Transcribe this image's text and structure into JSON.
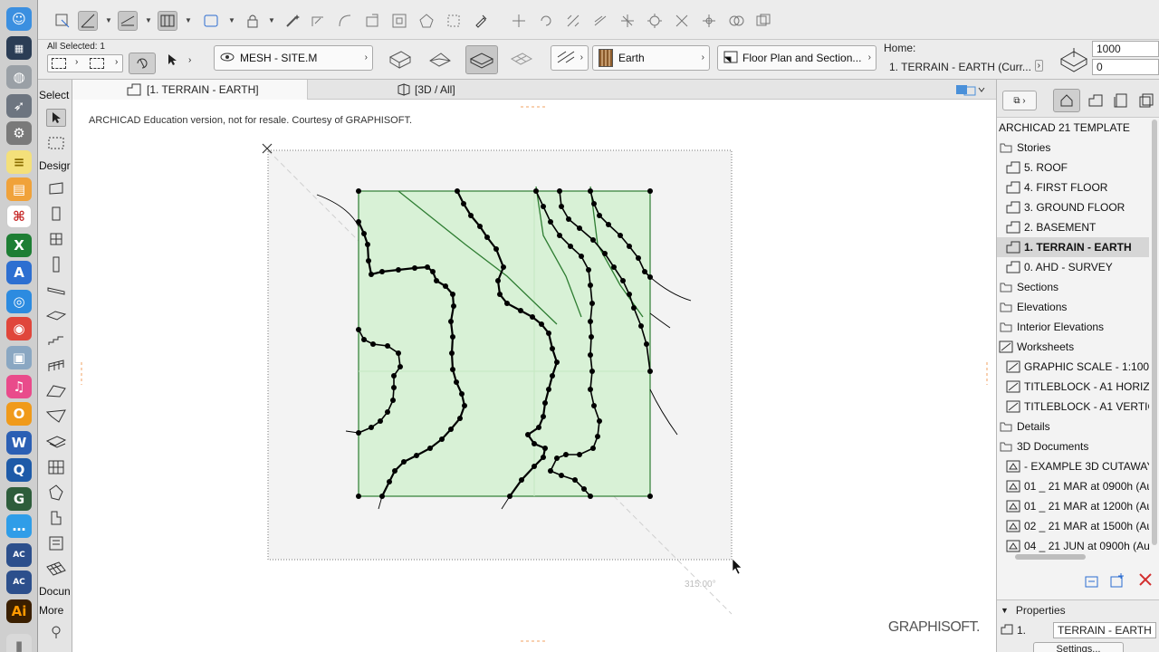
{
  "toolbox": {
    "select_label": "Select",
    "design_label": "Desigr",
    "document_label": "Docun",
    "more_label": "More"
  },
  "infobox": {
    "all_selected": "All Selected: 1",
    "mesh_label": "MESH - SITE.M",
    "surface_label": "Earth",
    "view_label": "Floor Plan and Section...",
    "home_label": "Home:",
    "home_story": "1. TERRAIN - EARTH (Curr...",
    "value_top": "1000",
    "value_bottom": "0"
  },
  "tabs": [
    {
      "label": "[1. TERRAIN - EARTH]"
    },
    {
      "label": "[3D / All]"
    }
  ],
  "canvas": {
    "watermark_note": "ARCHICAD Education version, not for resale. Courtesy of GRAPHISOFT.",
    "angle_label": "315.00°",
    "logo": "GRAPHISOFT."
  },
  "navigator": {
    "project_title": "ARCHICAD 21 TEMPLATE",
    "items": [
      {
        "label": "Stories",
        "level": 0,
        "icon": "folder-icon"
      },
      {
        "label": "5. ROOF",
        "level": 1,
        "icon": "story-icon"
      },
      {
        "label": "4. FIRST FLOOR",
        "level": 1,
        "icon": "story-icon"
      },
      {
        "label": "3. GROUND FLOOR",
        "level": 1,
        "icon": "story-icon"
      },
      {
        "label": "2. BASEMENT",
        "level": 1,
        "icon": "story-icon"
      },
      {
        "label": "1. TERRAIN - EARTH",
        "level": 1,
        "icon": "story-icon",
        "selected": true
      },
      {
        "label": "0. AHD - SURVEY",
        "level": 1,
        "icon": "story-icon"
      },
      {
        "label": "Sections",
        "level": 0,
        "icon": "folder-icon"
      },
      {
        "label": "Elevations",
        "level": 0,
        "icon": "folder-icon"
      },
      {
        "label": "Interior Elevations",
        "level": 0,
        "icon": "folder-icon"
      },
      {
        "label": "Worksheets",
        "level": 0,
        "icon": "worksheet-icon"
      },
      {
        "label": "GRAPHIC SCALE - 1:100",
        "level": 1,
        "icon": "worksheet-icon"
      },
      {
        "label": "TITLEBLOCK - A1 HORIZ",
        "level": 1,
        "icon": "worksheet-icon"
      },
      {
        "label": "TITLEBLOCK - A1 VERTIC",
        "level": 1,
        "icon": "worksheet-icon"
      },
      {
        "label": "Details",
        "level": 0,
        "icon": "folder-icon"
      },
      {
        "label": "3D Documents",
        "level": 0,
        "icon": "folder-icon"
      },
      {
        "label": "- EXAMPLE 3D CUTAWAY",
        "level": 1,
        "icon": "document3d-icon"
      },
      {
        "label": "01 _ 21 MAR at 0900h (Au",
        "level": 1,
        "icon": "document3d-icon"
      },
      {
        "label": "01 _ 21 MAR at 1200h (Au",
        "level": 1,
        "icon": "document3d-icon"
      },
      {
        "label": "02 _ 21 MAR at 1500h (Au",
        "level": 1,
        "icon": "document3d-icon"
      },
      {
        "label": "04 _ 21 JUN at 0900h (Au",
        "level": 1,
        "icon": "document3d-icon"
      }
    ],
    "properties_label": "Properties",
    "prop_id": "1.",
    "prop_name": "TERRAIN - EARTH",
    "settings_label": "Settings..."
  },
  "colors": {
    "mesh_fill": "#d8f1d6",
    "mesh_edge": "#2e7d32",
    "contour": "#000000",
    "selected_row": "#d6d6d6"
  }
}
